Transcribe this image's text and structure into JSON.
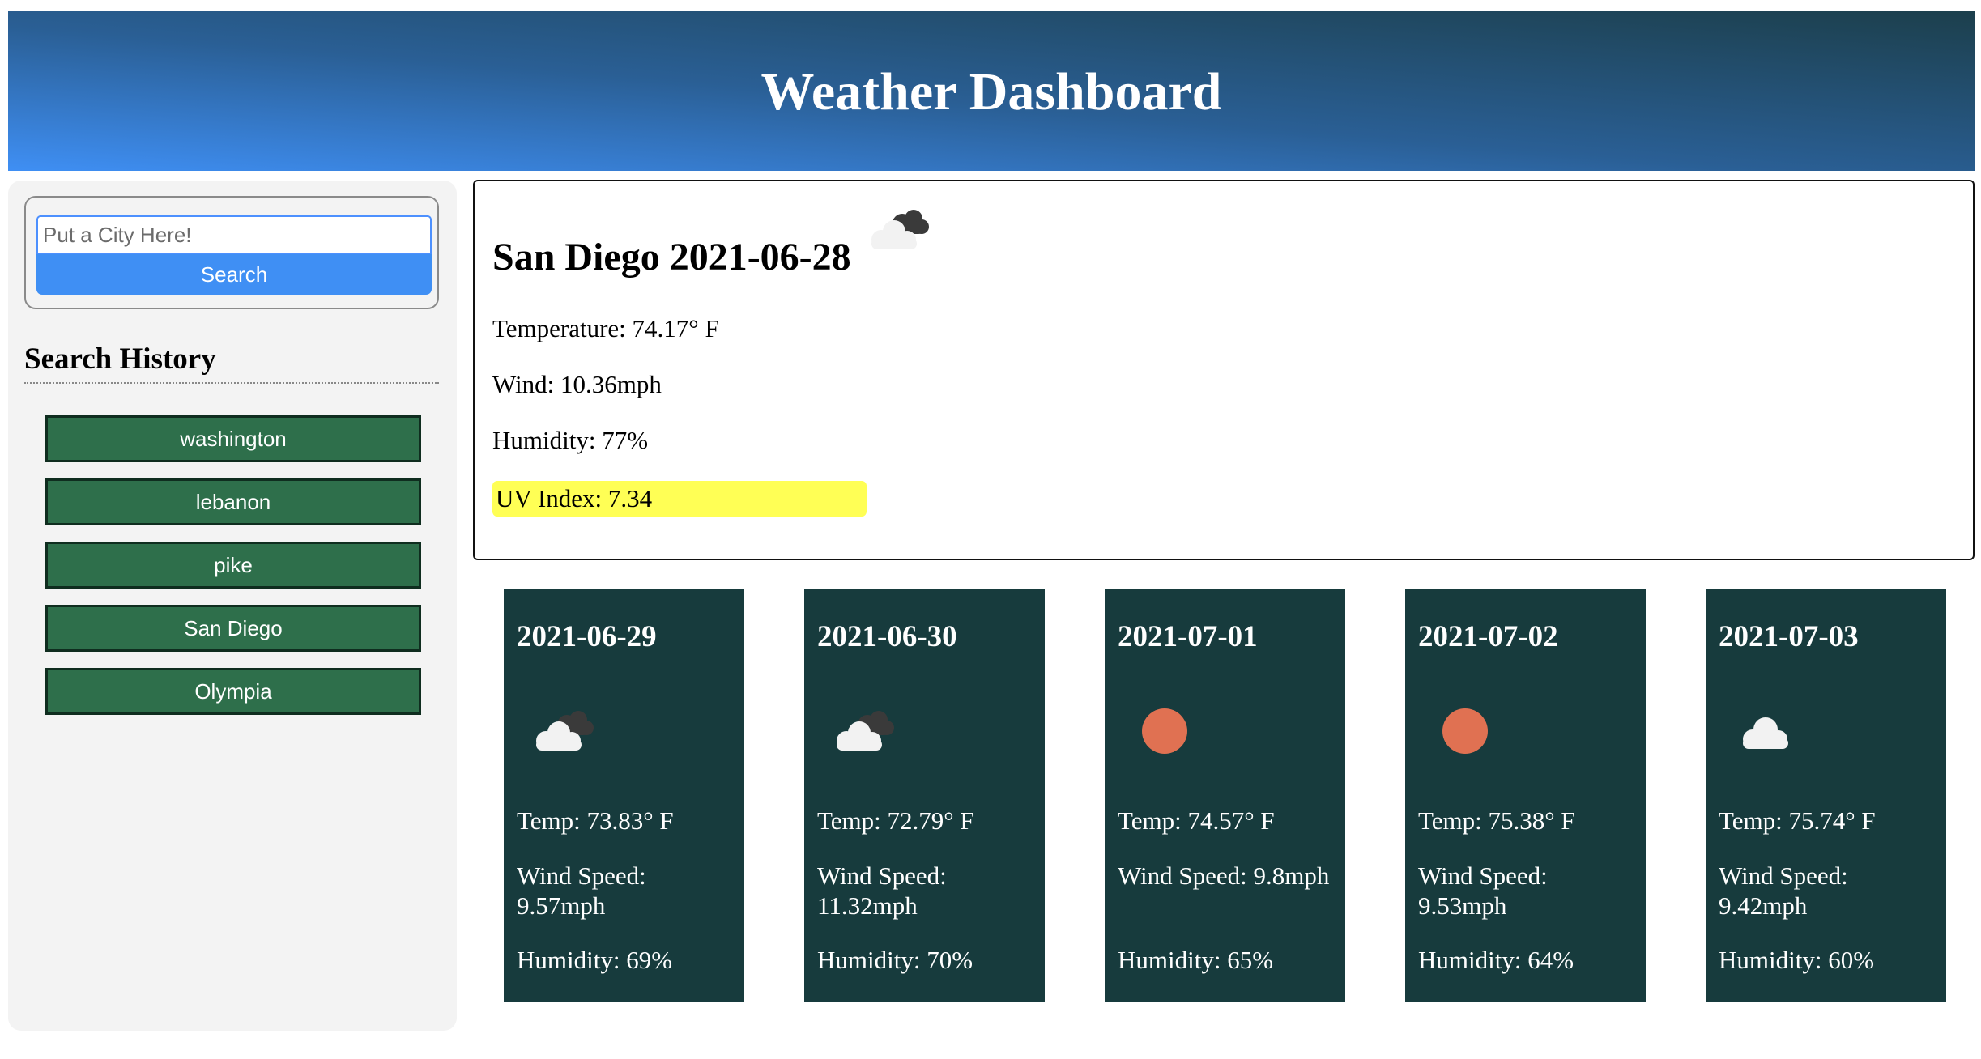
{
  "header": {
    "title": "Weather Dashboard"
  },
  "search": {
    "placeholder": "Put a City Here!",
    "button_label": "Search"
  },
  "history": {
    "title": "Search History",
    "items": [
      "washington",
      "lebanon",
      "pike",
      "San Diego",
      "Olympia"
    ]
  },
  "current": {
    "title": "San Diego 2021-06-28",
    "icon": "cloudy-icon",
    "temperature": "Temperature: 74.17° F",
    "wind": "Wind: 10.36mph",
    "humidity": "Humidity: 77%",
    "uv": "UV Index: 7.34",
    "uv_color": "#ffff55"
  },
  "forecast": [
    {
      "date": "2021-06-29",
      "icon": "cloudy-icon",
      "temp": "Temp: 73.83° F",
      "wind": "Wind Speed: 9.57mph",
      "humidity": "Humidity: 69%"
    },
    {
      "date": "2021-06-30",
      "icon": "cloudy-icon",
      "temp": "Temp: 72.79° F",
      "wind": "Wind Speed: 11.32mph",
      "humidity": "Humidity: 70%"
    },
    {
      "date": "2021-07-01",
      "icon": "sun-icon",
      "temp": "Temp: 74.57° F",
      "wind": "Wind Speed: 9.8mph",
      "humidity": "Humidity: 65%"
    },
    {
      "date": "2021-07-02",
      "icon": "sun-icon",
      "temp": "Temp: 75.38° F",
      "wind": "Wind Speed: 9.53mph",
      "humidity": "Humidity: 64%"
    },
    {
      "date": "2021-07-03",
      "icon": "cloud-icon",
      "temp": "Temp: 75.74° F",
      "wind": "Wind Speed: 9.42mph",
      "humidity": "Humidity: 60%"
    }
  ],
  "colors": {
    "header_gradient_start": "#3f8ff4",
    "header_gradient_end": "#1c3f4c",
    "history_button": "#2e6f4b",
    "forecast_card": "#173b3d",
    "search_button": "#3f8ff4",
    "sun": "#e07152"
  }
}
